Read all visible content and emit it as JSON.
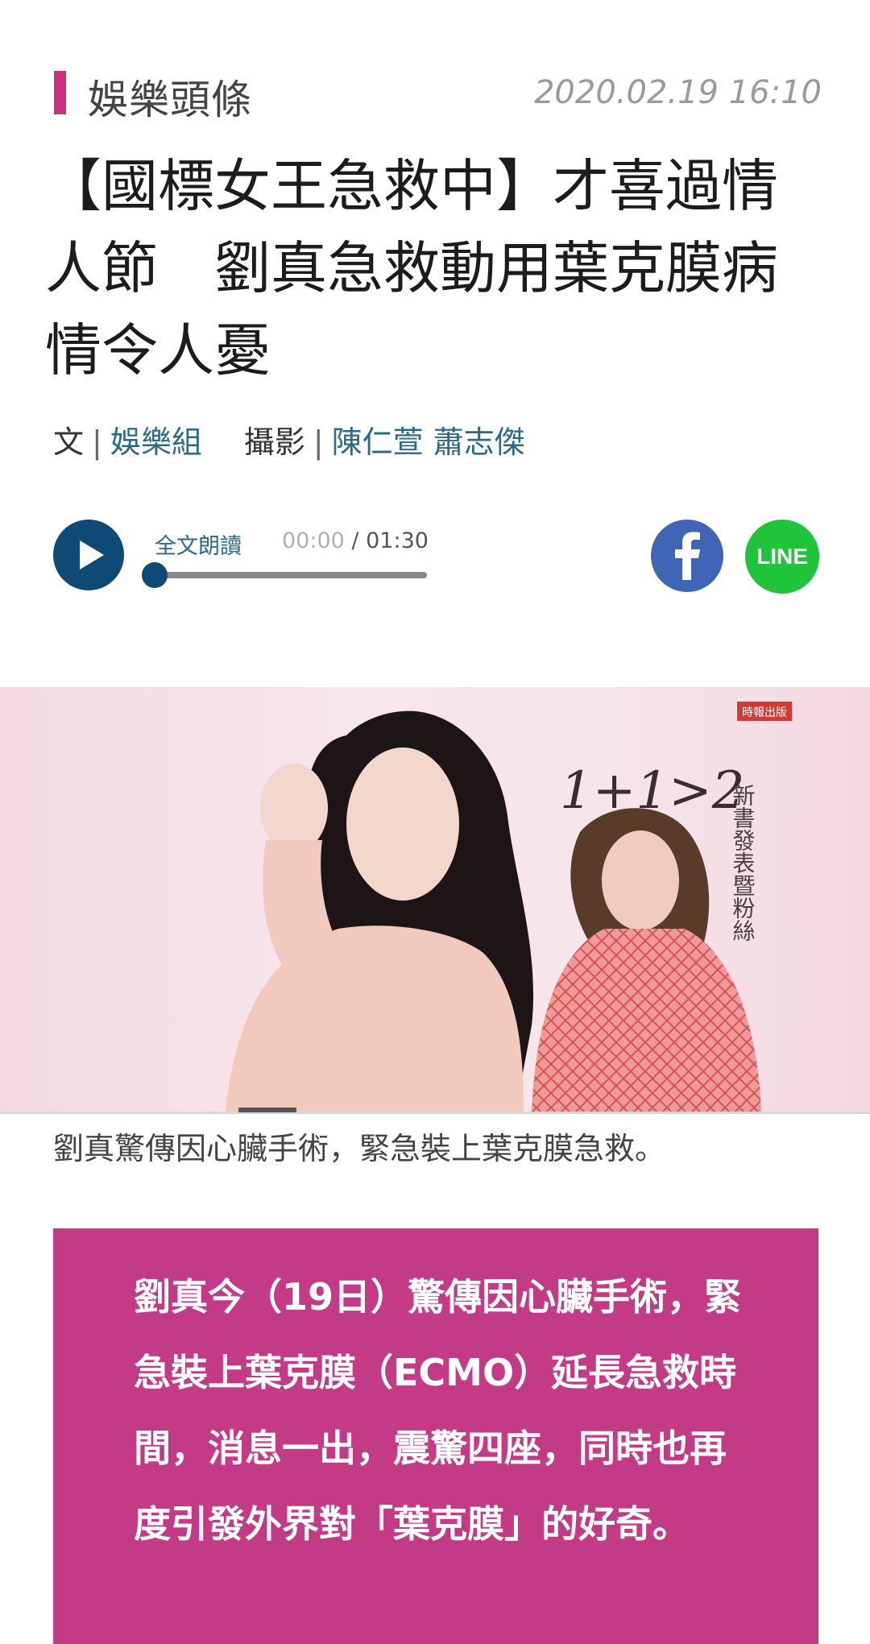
{
  "header": {
    "category": "娛樂頭條",
    "timestamp": "2020.02.19 16:10",
    "accent_color": "#c8327f"
  },
  "headline": "【國標女王急救中】才喜過情人節　劉真急救動用葉克膜病情令人憂",
  "byline": {
    "text_prefix": "文",
    "separator": "|",
    "author": "娛樂組",
    "photo_prefix": "攝影",
    "photographers": "陳仁萱 蕭志傑"
  },
  "audio": {
    "label": "全文朗讀",
    "current_time": "00:00",
    "slash": "/",
    "total_time": "01:30",
    "progress": 0
  },
  "share": {
    "facebook_icon": "facebook-icon",
    "line_label": "LINE"
  },
  "hero": {
    "book_text_numbers": "1+1>2",
    "book_text_vertical": "新書發表暨粉絲",
    "publisher_logo": "時報出版"
  },
  "caption": "劉真驚傳因心臟手術，緊急裝上葉克膜急救。",
  "quote": {
    "text": "劉真今（19日）驚傳因心臟手術，緊急裝上葉克膜（ECMO）延長急救時間，消息一出，震驚四座，同時也再度引發外界對「葉克膜」的好奇。",
    "bg_color": "#c33a87"
  }
}
